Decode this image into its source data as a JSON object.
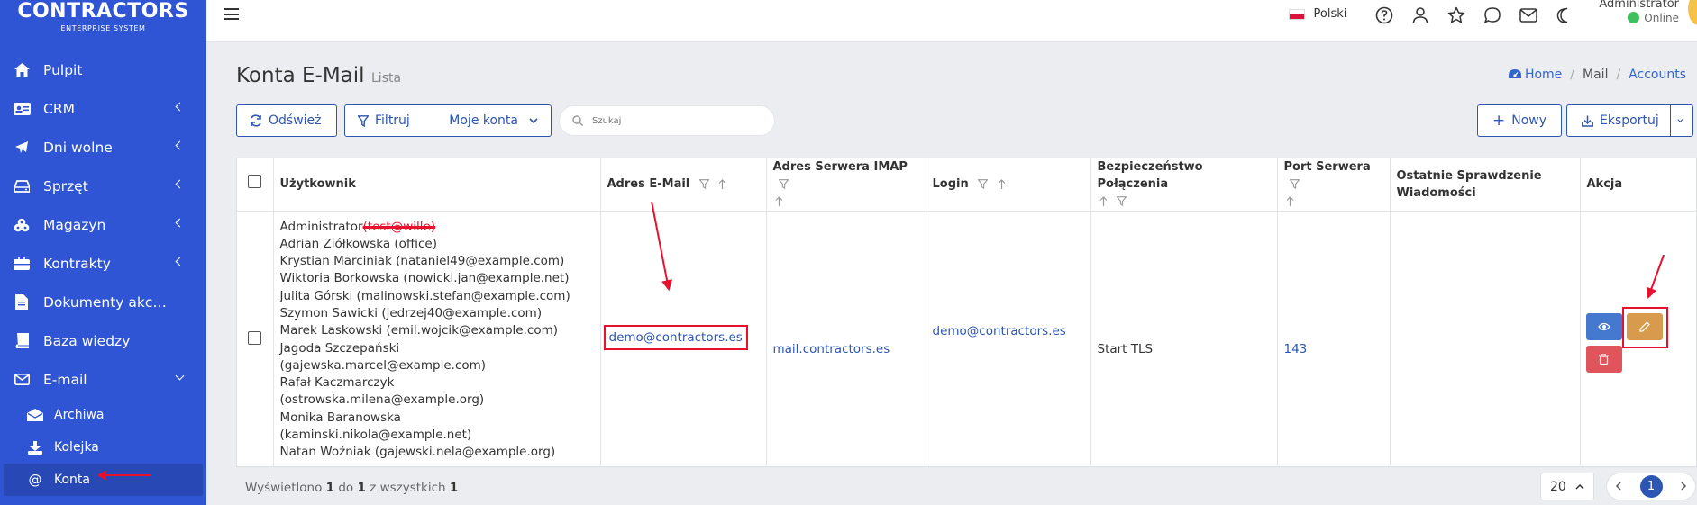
{
  "app": {
    "logo_text": "CONTRACTORS",
    "logo_tagline": "ENTERPRISE SYSTEM"
  },
  "sidebar": {
    "items": [
      {
        "label": "Pulpit",
        "icon": "home-icon"
      },
      {
        "label": "CRM",
        "icon": "id-card-icon"
      },
      {
        "label": "Dni wolne",
        "icon": "plane-icon"
      },
      {
        "label": "Sprzęt",
        "icon": "hdd-icon"
      },
      {
        "label": "Magazyn",
        "icon": "boxes-icon"
      },
      {
        "label": "Kontrakty",
        "icon": "briefcase-icon"
      },
      {
        "label": "Dokumenty akceptacji",
        "icon": "file-icon"
      },
      {
        "label": "Baza wiedzy",
        "icon": "book-icon"
      },
      {
        "label": "E-mail",
        "icon": "envelope-icon"
      }
    ],
    "email_sub": [
      {
        "label": "Archiwa",
        "icon": "envelope-open-icon"
      },
      {
        "label": "Kolejka",
        "icon": "download-icon"
      },
      {
        "label": "Konta",
        "icon": "at-icon"
      }
    ]
  },
  "topbar": {
    "language": "Polski",
    "user_name": "Administrator",
    "user_status": "Online"
  },
  "page": {
    "title": "Konta E-Mail",
    "subtitle": "Lista",
    "breadcrumb": [
      "Home",
      "Mail",
      "Accounts"
    ]
  },
  "toolbar": {
    "refresh": "Odśwież",
    "filter": "Filtruj",
    "my_accounts": "Moje konta",
    "search_placeholder": "Szukaj",
    "new": "Nowy",
    "export": "Eksportuj"
  },
  "table": {
    "headers": {
      "user": "Użytkownik",
      "email": "Adres E-Mail",
      "imap": "Adres Serwera IMAP",
      "login": "Login",
      "security": "Bezpieczeństwo Połączenia",
      "port": "Port Serwera",
      "last_check": "Ostatnie Sprawdzenie Wiadomości",
      "action": "Akcja"
    },
    "row": {
      "users_first": "Administrator",
      "users_first_struck": "(test@wille)",
      "users": [
        "Adrian Ziółkowska (office)",
        "Krystian Marciniak (nataniel49@example.com)",
        "Wiktoria Borkowska (nowicki.jan@example.net)",
        "Julita Górski (malinowski.stefan@example.com)",
        "Szymon Sawicki (jedrzej40@example.com)",
        "Marek Laskowski (emil.wojcik@example.com)",
        "Jagoda Szczepański",
        "(gajewska.marcel@example.com)",
        "Rafał Kaczmarczyk",
        "(ostrowska.milena@example.org)",
        "Monika Baranowska",
        "(kaminski.nikola@example.net)",
        "Natan Woźniak (gajewski.nela@example.org)"
      ],
      "email": "demo@contractors.es",
      "imap": "mail.contractors.es",
      "login": "demo@contractors.es",
      "security": "Start TLS",
      "port": "143",
      "last_check": ""
    }
  },
  "footer": {
    "prefix": "Wyświetlono",
    "from": "1",
    "to_word": "do",
    "to": "1",
    "of_word": "z wszystkich",
    "total": "1",
    "page_size": "20",
    "current_page": "1"
  },
  "colors": {
    "sidebar": "#2f55d4",
    "primary": "#2d55b3",
    "annotation": "#e8112d",
    "edit": "#d89a4c",
    "delete": "#e0555c",
    "view": "#4479cf"
  }
}
